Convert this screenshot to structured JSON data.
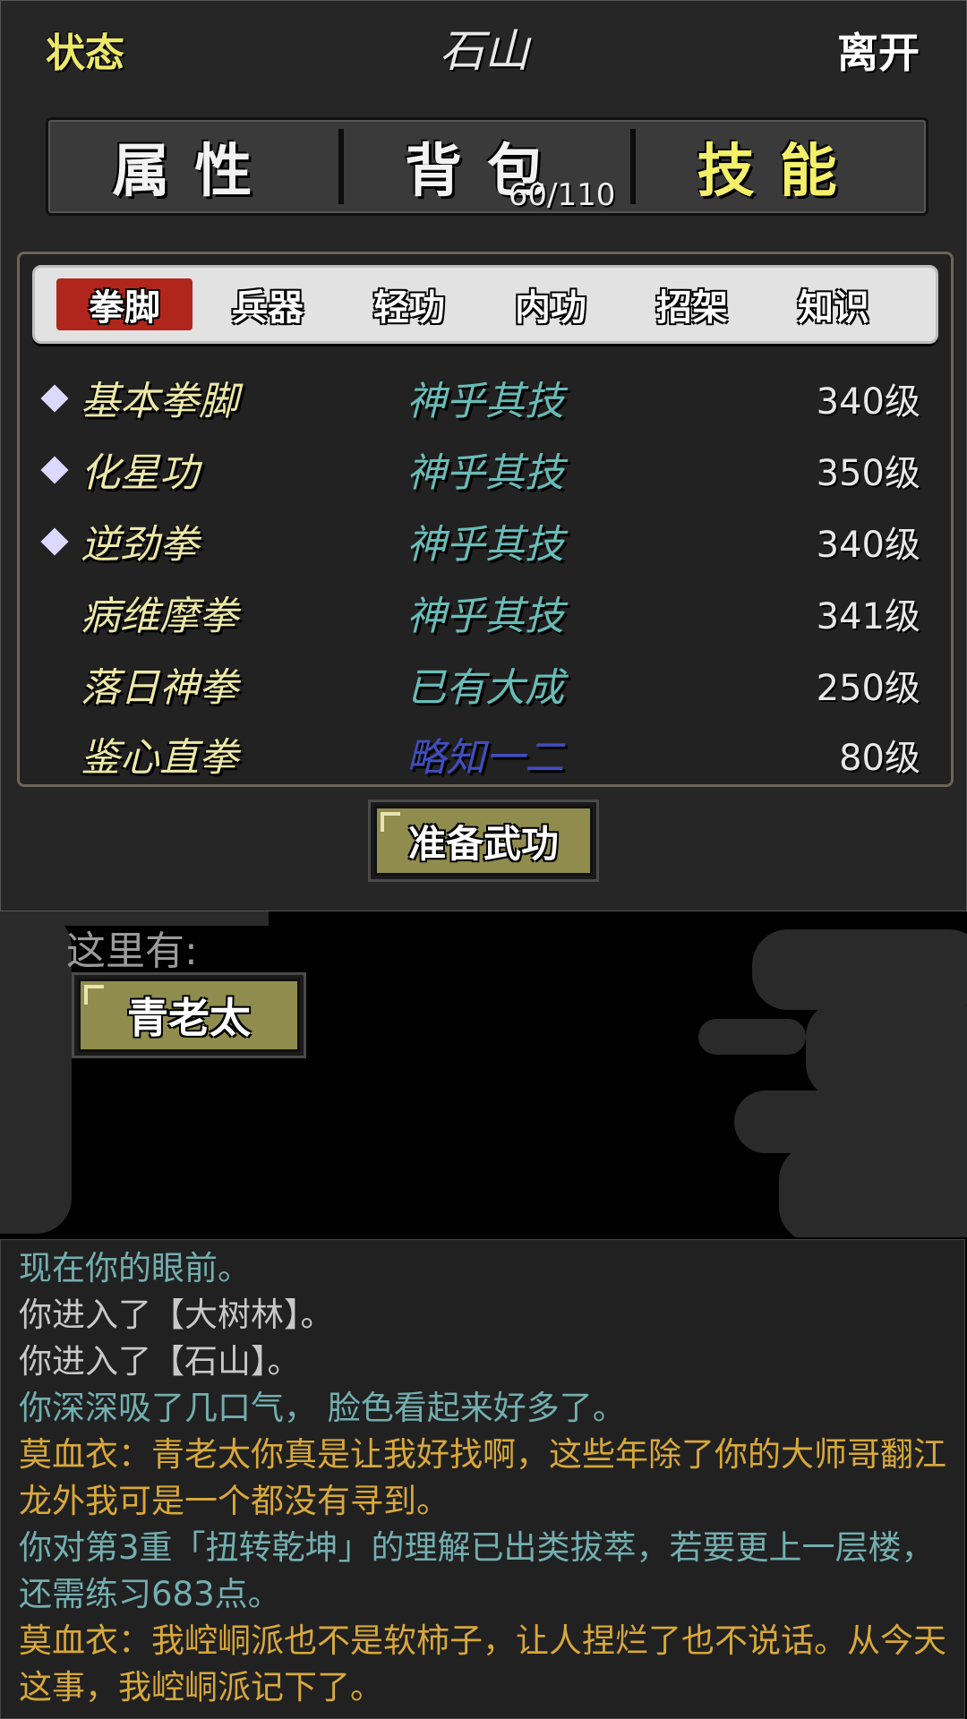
{
  "header": {
    "status_label": "状态",
    "location": "石山",
    "leave_label": "离开"
  },
  "main_tabs": {
    "attributes": "属性",
    "bag": "背包",
    "bag_count": "60/110",
    "skills": "技能",
    "active": "skills"
  },
  "sub_tabs": [
    {
      "label": "拳脚",
      "active": true
    },
    {
      "label": "兵器",
      "active": false
    },
    {
      "label": "轻功",
      "active": false
    },
    {
      "label": "内功",
      "active": false
    },
    {
      "label": "招架",
      "active": false
    },
    {
      "label": "知识",
      "active": false
    }
  ],
  "skills": [
    {
      "name": "基本拳脚",
      "equipped": true,
      "mastery": "神乎其技",
      "level": "340级"
    },
    {
      "name": "化星功",
      "equipped": true,
      "mastery": "神乎其技",
      "level": "350级"
    },
    {
      "name": "逆劲拳",
      "equipped": true,
      "mastery": "神乎其技",
      "level": "340级"
    },
    {
      "name": "病维摩拳",
      "equipped": false,
      "mastery": "神乎其技",
      "level": "341级"
    },
    {
      "name": "落日神拳",
      "equipped": false,
      "mastery": "已有大成",
      "level": "250级"
    },
    {
      "name": "鉴心直拳",
      "equipped": false,
      "mastery": "略知一二",
      "level": "80级"
    }
  ],
  "prepare_button": "准备武功",
  "scene": {
    "here_label": "这里有:",
    "npc": "青老太"
  },
  "log": [
    {
      "text": "现在你的眼前。",
      "color": "teal"
    },
    {
      "text": "你进入了【大树林】。",
      "color": "gray"
    },
    {
      "text": "你进入了【石山】。",
      "color": "gray"
    },
    {
      "text": "你深深吸了几口气， 脸色看起来好多了。",
      "color": "teal"
    },
    {
      "text": "莫血衣：青老太你真是让我好找啊，这些年除了你的大师哥翻江龙外我可是一个都没有寻到。",
      "color": "gold"
    },
    {
      "text": "你对第3重「扭转乾坤」的理解已出类拔萃，若要更上一层楼，还需练习683点。",
      "color": "teal"
    },
    {
      "text": "莫血衣：我崆峒派也不是软柿子，让人捏烂了也不说话。从今天这事，我崆峒派记下了。",
      "color": "gold"
    }
  ],
  "colors": {
    "accent_yellow": "#f4f06a",
    "active_subtab": "#b1261c",
    "mastery_teal": "#67bcb8",
    "mastery_low": "#3f4fc0",
    "button_olive": "#8f8c4e",
    "log_gold": "#d8a83a"
  }
}
